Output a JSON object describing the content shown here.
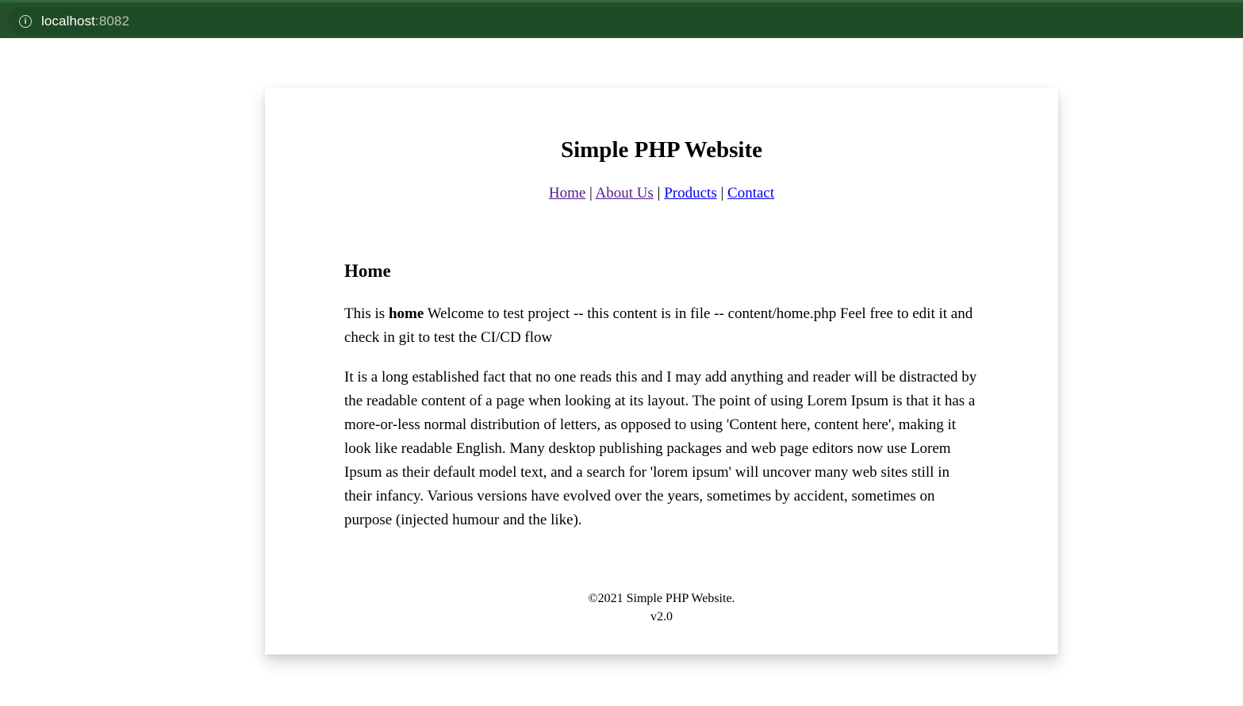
{
  "browser": {
    "url_host": "localhost",
    "url_port": ":8082"
  },
  "site": {
    "title": "Simple PHP Website"
  },
  "nav": {
    "home": "Home",
    "about": "About Us",
    "products": "Products",
    "contact": "Contact",
    "separator": "|"
  },
  "content": {
    "heading": "Home",
    "intro_prefix": "This is ",
    "intro_bold": "home",
    "intro_rest": " Welcome to test project -- this content is in file -- content/home.php Feel free to edit it and check in git to test the CI/CD flow",
    "body": "It is a long established fact that no one reads this and I may add anything and reader will be distracted by the readable content of a page when looking at its layout. The point of using Lorem Ipsum is that it has a more-or-less normal distribution of letters, as opposed to using 'Content here, content here', making it look like readable English. Many desktop publishing packages and web page editors now use Lorem Ipsum as their default model text, and a search for 'lorem ipsum' will uncover many web sites still in their infancy. Various versions have evolved over the years, sometimes by accident, sometimes on purpose (injected humour and the like)."
  },
  "footer": {
    "copyright": "©2021 Simple PHP Website.",
    "version": "v2.0"
  }
}
